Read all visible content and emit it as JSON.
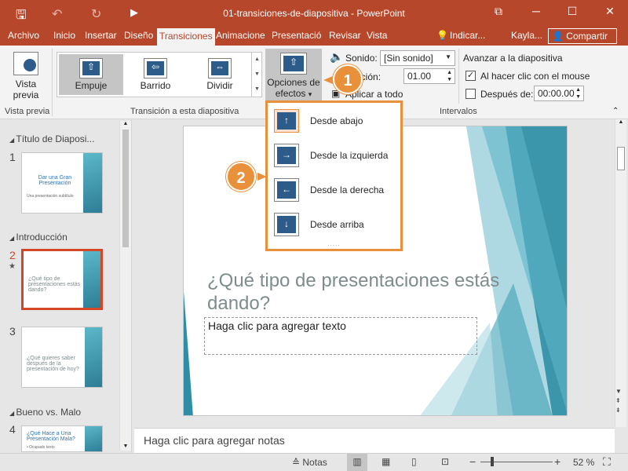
{
  "window": {
    "title": "01-transiciones-de-diapositiva - PowerPoint",
    "minimize": "─",
    "maximize": "☐",
    "close": "✕",
    "restore_ribbon": "⧉"
  },
  "qat": {
    "save": "🖫",
    "undo": "↶",
    "redo": "↻",
    "start": "▶"
  },
  "tabs": {
    "archivo": "Archivo",
    "inicio": "Inicio",
    "insertar": "Insertar",
    "diseno": "Diseño",
    "transiciones": "Transiciones",
    "animaciones": "Animacione",
    "presentacion": "Presentació",
    "revisar": "Revisar",
    "vista": "Vista",
    "indicar": "Indicar...",
    "user": "Kayla...",
    "share": "Compartir"
  },
  "ribbon": {
    "preview_label_1": "Vista",
    "preview_label_2": "previa",
    "group_preview": "Vista previa",
    "gallery": [
      {
        "label": "Empuje",
        "glyph": "⇧"
      },
      {
        "label": "Barrido",
        "glyph": "⇦"
      },
      {
        "label": "Dividir",
        "glyph": "⇔"
      }
    ],
    "group_transition": "Transición a esta diapositiva",
    "options_label_1": "Opciones de",
    "options_label_2": "efectos",
    "options_caret": "▾",
    "sound_label": "Sonido:",
    "sound_value": "[Sin sonido]",
    "duration_label": "ación:",
    "duration_value": "01.00",
    "apply_all": "Aplicar a todo",
    "advance_header": "Avanzar a la diapositiva",
    "on_click_label": "Al hacer clic con el mouse",
    "on_click_checked": true,
    "after_label": "Después de:",
    "after_value": "00:00.00",
    "group_timing": "Intervalos"
  },
  "callouts": {
    "one": "1",
    "two": "2"
  },
  "dropdown": {
    "items": [
      {
        "label": "Desde abajo",
        "glyph": "↑"
      },
      {
        "label": "Desde la izquierda",
        "glyph": "→"
      },
      {
        "label": "Desde la derecha",
        "glyph": "←"
      },
      {
        "label": "Desde arriba",
        "glyph": "↓"
      }
    ],
    "grip": "....."
  },
  "slide_pane": {
    "sections": [
      {
        "name": "Título de Diaposi..."
      },
      {
        "name": "Introducción"
      },
      {
        "name": "Bueno vs. Malo"
      }
    ],
    "slides": [
      {
        "num": "1",
        "title": "Dar una Gran Presentación",
        "body": "Una presentación subtítulo"
      },
      {
        "num": "2",
        "title": "¿Qué tipo de presentaciones estás dando?",
        "body": ""
      },
      {
        "num": "3",
        "title": "¿Qué quieres saber después de la presentación de hoy?",
        "body": ""
      },
      {
        "num": "4",
        "title": "¿Qué Hace a Una Presentación Mala?",
        "body": "• Ocupado texto"
      }
    ],
    "star": "★"
  },
  "main_slide": {
    "title": "¿Qué tipo de presentaciones estás dando?",
    "body_placeholder": "Haga clic para agregar texto"
  },
  "notes": {
    "placeholder": "Haga clic para agregar notas"
  },
  "status": {
    "notes": "Notas",
    "zoom_minus": "−",
    "zoom_plus": "+",
    "zoom": "52 %"
  },
  "colors": {
    "accent": "#b7472a",
    "callout": "#e8913a",
    "slide_teal": "#4aa3b8"
  }
}
